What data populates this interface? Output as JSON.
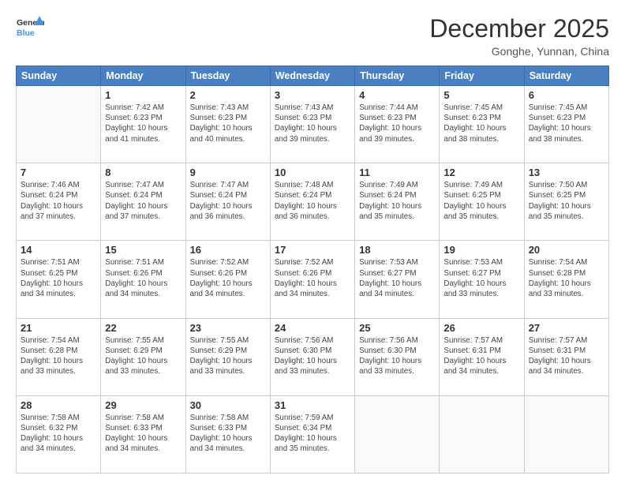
{
  "header": {
    "logo_general": "General",
    "logo_blue": "Blue",
    "month_title": "December 2025",
    "location": "Gonghe, Yunnan, China"
  },
  "weekdays": [
    "Sunday",
    "Monday",
    "Tuesday",
    "Wednesday",
    "Thursday",
    "Friday",
    "Saturday"
  ],
  "weeks": [
    [
      {
        "day": "",
        "info": ""
      },
      {
        "day": "1",
        "info": "Sunrise: 7:42 AM\nSunset: 6:23 PM\nDaylight: 10 hours\nand 41 minutes."
      },
      {
        "day": "2",
        "info": "Sunrise: 7:43 AM\nSunset: 6:23 PM\nDaylight: 10 hours\nand 40 minutes."
      },
      {
        "day": "3",
        "info": "Sunrise: 7:43 AM\nSunset: 6:23 PM\nDaylight: 10 hours\nand 39 minutes."
      },
      {
        "day": "4",
        "info": "Sunrise: 7:44 AM\nSunset: 6:23 PM\nDaylight: 10 hours\nand 39 minutes."
      },
      {
        "day": "5",
        "info": "Sunrise: 7:45 AM\nSunset: 6:23 PM\nDaylight: 10 hours\nand 38 minutes."
      },
      {
        "day": "6",
        "info": "Sunrise: 7:45 AM\nSunset: 6:23 PM\nDaylight: 10 hours\nand 38 minutes."
      }
    ],
    [
      {
        "day": "7",
        "info": "Sunrise: 7:46 AM\nSunset: 6:24 PM\nDaylight: 10 hours\nand 37 minutes."
      },
      {
        "day": "8",
        "info": "Sunrise: 7:47 AM\nSunset: 6:24 PM\nDaylight: 10 hours\nand 37 minutes."
      },
      {
        "day": "9",
        "info": "Sunrise: 7:47 AM\nSunset: 6:24 PM\nDaylight: 10 hours\nand 36 minutes."
      },
      {
        "day": "10",
        "info": "Sunrise: 7:48 AM\nSunset: 6:24 PM\nDaylight: 10 hours\nand 36 minutes."
      },
      {
        "day": "11",
        "info": "Sunrise: 7:49 AM\nSunset: 6:24 PM\nDaylight: 10 hours\nand 35 minutes."
      },
      {
        "day": "12",
        "info": "Sunrise: 7:49 AM\nSunset: 6:25 PM\nDaylight: 10 hours\nand 35 minutes."
      },
      {
        "day": "13",
        "info": "Sunrise: 7:50 AM\nSunset: 6:25 PM\nDaylight: 10 hours\nand 35 minutes."
      }
    ],
    [
      {
        "day": "14",
        "info": "Sunrise: 7:51 AM\nSunset: 6:25 PM\nDaylight: 10 hours\nand 34 minutes."
      },
      {
        "day": "15",
        "info": "Sunrise: 7:51 AM\nSunset: 6:26 PM\nDaylight: 10 hours\nand 34 minutes."
      },
      {
        "day": "16",
        "info": "Sunrise: 7:52 AM\nSunset: 6:26 PM\nDaylight: 10 hours\nand 34 minutes."
      },
      {
        "day": "17",
        "info": "Sunrise: 7:52 AM\nSunset: 6:26 PM\nDaylight: 10 hours\nand 34 minutes."
      },
      {
        "day": "18",
        "info": "Sunrise: 7:53 AM\nSunset: 6:27 PM\nDaylight: 10 hours\nand 34 minutes."
      },
      {
        "day": "19",
        "info": "Sunrise: 7:53 AM\nSunset: 6:27 PM\nDaylight: 10 hours\nand 33 minutes."
      },
      {
        "day": "20",
        "info": "Sunrise: 7:54 AM\nSunset: 6:28 PM\nDaylight: 10 hours\nand 33 minutes."
      }
    ],
    [
      {
        "day": "21",
        "info": "Sunrise: 7:54 AM\nSunset: 6:28 PM\nDaylight: 10 hours\nand 33 minutes."
      },
      {
        "day": "22",
        "info": "Sunrise: 7:55 AM\nSunset: 6:29 PM\nDaylight: 10 hours\nand 33 minutes."
      },
      {
        "day": "23",
        "info": "Sunrise: 7:55 AM\nSunset: 6:29 PM\nDaylight: 10 hours\nand 33 minutes."
      },
      {
        "day": "24",
        "info": "Sunrise: 7:56 AM\nSunset: 6:30 PM\nDaylight: 10 hours\nand 33 minutes."
      },
      {
        "day": "25",
        "info": "Sunrise: 7:56 AM\nSunset: 6:30 PM\nDaylight: 10 hours\nand 33 minutes."
      },
      {
        "day": "26",
        "info": "Sunrise: 7:57 AM\nSunset: 6:31 PM\nDaylight: 10 hours\nand 34 minutes."
      },
      {
        "day": "27",
        "info": "Sunrise: 7:57 AM\nSunset: 6:31 PM\nDaylight: 10 hours\nand 34 minutes."
      }
    ],
    [
      {
        "day": "28",
        "info": "Sunrise: 7:58 AM\nSunset: 6:32 PM\nDaylight: 10 hours\nand 34 minutes."
      },
      {
        "day": "29",
        "info": "Sunrise: 7:58 AM\nSunset: 6:33 PM\nDaylight: 10 hours\nand 34 minutes."
      },
      {
        "day": "30",
        "info": "Sunrise: 7:58 AM\nSunset: 6:33 PM\nDaylight: 10 hours\nand 34 minutes."
      },
      {
        "day": "31",
        "info": "Sunrise: 7:59 AM\nSunset: 6:34 PM\nDaylight: 10 hours\nand 35 minutes."
      },
      {
        "day": "",
        "info": ""
      },
      {
        "day": "",
        "info": ""
      },
      {
        "day": "",
        "info": ""
      }
    ]
  ]
}
